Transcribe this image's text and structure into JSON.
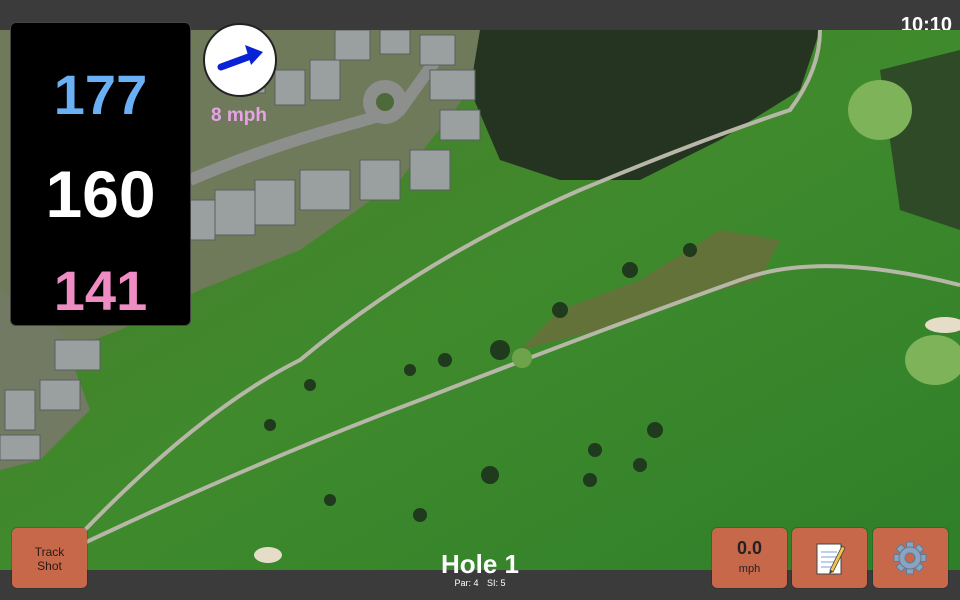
{
  "status_bar": {
    "time": "10:10"
  },
  "distances": {
    "back": "177",
    "middle": "160",
    "front": "141",
    "colors": {
      "back": "#6ab0f5",
      "middle": "#ffffff",
      "front": "#f08cc4"
    }
  },
  "wind": {
    "speed_label": "8 mph",
    "direction_icon": "arrow-icon"
  },
  "buttons": {
    "track_shot_line1": "Track",
    "track_shot_line2": "Shot",
    "speed_value": "0.0",
    "speed_unit": "mph",
    "notes_icon": "notepad-icon",
    "settings_icon": "gear-icon"
  },
  "hole": {
    "title": "Hole 1",
    "par_label": "Par: 4",
    "si_label": "SI: 5"
  },
  "colors": {
    "button": "#c8684a",
    "bar": "#3b3b3b",
    "wind_text": "#e6a3e6"
  }
}
